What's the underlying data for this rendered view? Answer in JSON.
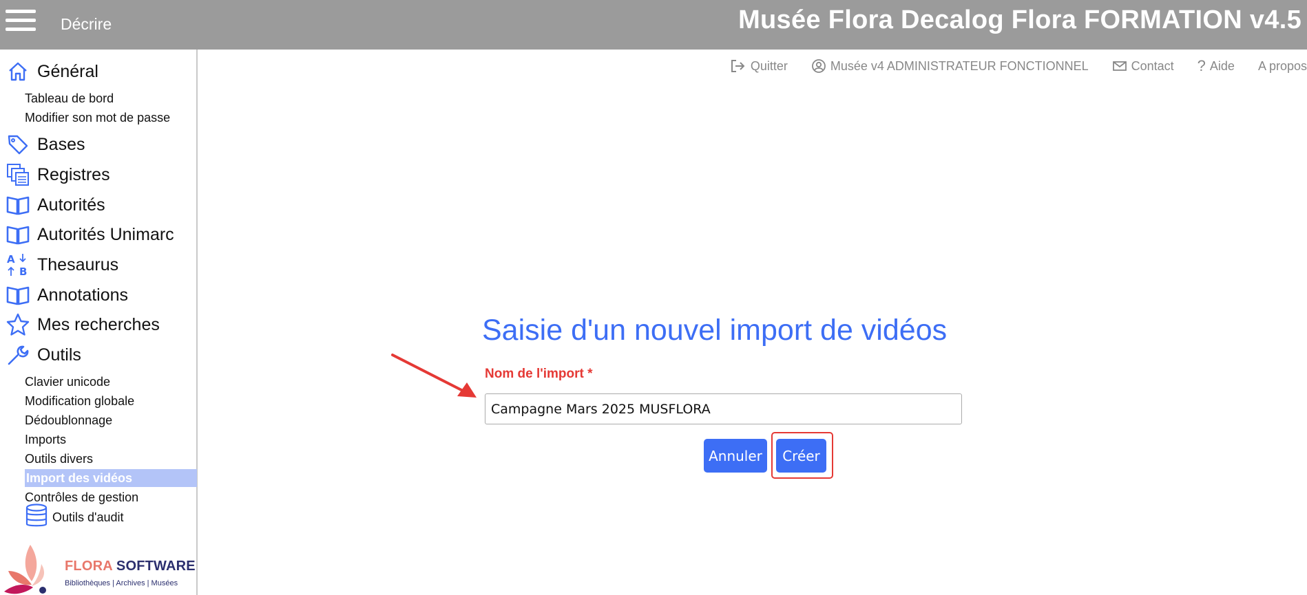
{
  "header": {
    "menu_icon": "hamburger-icon",
    "section": "Décrire",
    "app_title": "Musée Flora Decalog Flora FORMATION v4.5"
  },
  "sidebar": {
    "sections": [
      {
        "label": "Général",
        "icon": "home-icon",
        "items": [
          "Tableau de bord",
          "Modifier son mot de passe"
        ]
      },
      {
        "label": "Bases",
        "icon": "tag-icon",
        "items": []
      },
      {
        "label": "Registres",
        "icon": "stacked-pages-icon",
        "items": []
      },
      {
        "label": "Autorités",
        "icon": "open-book-icon",
        "items": []
      },
      {
        "label": "Autorités Unimarc",
        "icon": "open-book-icon",
        "items": []
      },
      {
        "label": "Thesaurus",
        "icon": "sort-az-icon",
        "items": []
      },
      {
        "label": "Annotations",
        "icon": "open-book-icon",
        "items": []
      },
      {
        "label": "Mes recherches",
        "icon": "star-icon",
        "items": []
      },
      {
        "label": "Outils",
        "icon": "wrench-icon",
        "items": [
          "Clavier unicode",
          "Modification globale",
          "Dédoublonnage",
          "Imports",
          "Outils divers",
          "Import des vidéos",
          "Contrôles de gestion"
        ]
      }
    ],
    "active_item": "Import des vidéos",
    "audit": {
      "label": "Outils d'audit",
      "icon": "database-icon"
    },
    "logo": {
      "brand_flora": "FLORA",
      "brand_software": "SOFTWARE",
      "tagline": "Bibliothèques | Archives | Musées"
    }
  },
  "toplinks": [
    {
      "label": "Quitter",
      "icon": "logout-icon"
    },
    {
      "label": "Musée v4 ADMINISTRATEUR FONCTIONNEL",
      "icon": "user-circle-icon"
    },
    {
      "label": "Contact",
      "icon": "envelope-icon"
    },
    {
      "label": "Aide",
      "icon": "question-icon"
    },
    {
      "label": "A propos",
      "icon": ""
    }
  ],
  "form": {
    "title": "Saisie d'un nouvel import de vidéos",
    "field_label": "Nom de l'import *",
    "field_value": "Campagne Mars 2025 MUSFLORA",
    "cancel_label": "Annuler",
    "create_label": "Créer"
  },
  "colors": {
    "accent": "#3d6ef5",
    "header_bg": "#9b9b9b",
    "required": "#e53935",
    "active_bg": "#b3c4f8"
  }
}
